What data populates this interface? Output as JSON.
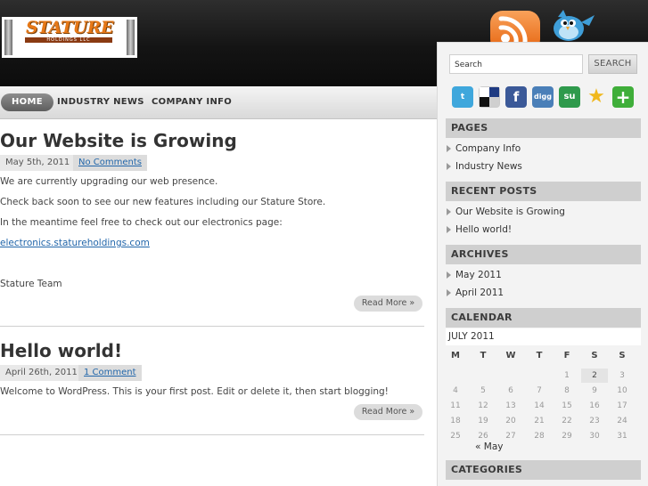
{
  "header": {
    "logo_text": "STATURE",
    "logo_sub": "HOLDINGS LLC",
    "rss_icon": "rss-icon",
    "twitter_icon": "twitter-bird-icon"
  },
  "nav": {
    "items": [
      "HOME",
      "INDUSTRY NEWS",
      "COMPANY INFO"
    ],
    "active": "HOME"
  },
  "posts": [
    {
      "title": "Our Website is Growing",
      "date": "May 5th, 2011",
      "comments": "No Comments",
      "lines": [
        "We are currently upgrading our web presence.",
        "Check back soon to see our new features including our Stature Store.",
        "In the meantime feel free to check out our electronics page:"
      ],
      "link": "electronics.statureholdings.com",
      "signature": "Stature Team",
      "read_more": "Read More »"
    },
    {
      "title": "Hello world!",
      "date": "April 26th, 2011",
      "comments": "1 Comment",
      "lines": [
        "Welcome to WordPress. This is your first post. Edit or delete it, then start blogging!"
      ],
      "read_more": "Read More »"
    }
  ],
  "sidebar": {
    "search": {
      "placeholder": "Search",
      "value": "Search",
      "button": "SEARCH"
    },
    "social_icons": [
      "twitter-icon",
      "delicious-icon",
      "facebook-icon",
      "digg-icon",
      "stumbleupon-icon",
      "favorite-star-icon",
      "add-plus-icon"
    ],
    "social_glyphs": {
      "digg": "digg",
      "stumble": "su",
      "facebook": "f",
      "twitter": "t",
      "star": "★",
      "plus": "+"
    },
    "pages": {
      "title": "PAGES",
      "items": [
        "Company Info",
        "Industry News"
      ]
    },
    "recent_posts": {
      "title": "RECENT POSTS",
      "items": [
        "Our Website is Growing",
        "Hello world!"
      ]
    },
    "archives": {
      "title": "ARCHIVES",
      "items": [
        "May 2011",
        "April 2011"
      ]
    },
    "calendar": {
      "title": "CALENDAR",
      "caption": "JULY 2011",
      "weekdays": [
        "M",
        "T",
        "W",
        "T",
        "F",
        "S",
        "S"
      ],
      "weeks": [
        [
          "",
          "",
          "",
          "",
          "1",
          "2",
          "3"
        ],
        [
          "4",
          "5",
          "6",
          "7",
          "8",
          "9",
          "10"
        ],
        [
          "11",
          "12",
          "13",
          "14",
          "15",
          "16",
          "17"
        ],
        [
          "18",
          "19",
          "20",
          "21",
          "22",
          "23",
          "24"
        ],
        [
          "25",
          "26",
          "27",
          "28",
          "29",
          "30",
          "31"
        ]
      ],
      "today": "2",
      "prev": "« May"
    },
    "categories": {
      "title": "CATEGORIES"
    }
  },
  "colors": {
    "header_bg": "#141414",
    "accent_orange": "#e67817",
    "link_blue": "#2266aa",
    "widget_title_bg": "#cfcfcf"
  }
}
